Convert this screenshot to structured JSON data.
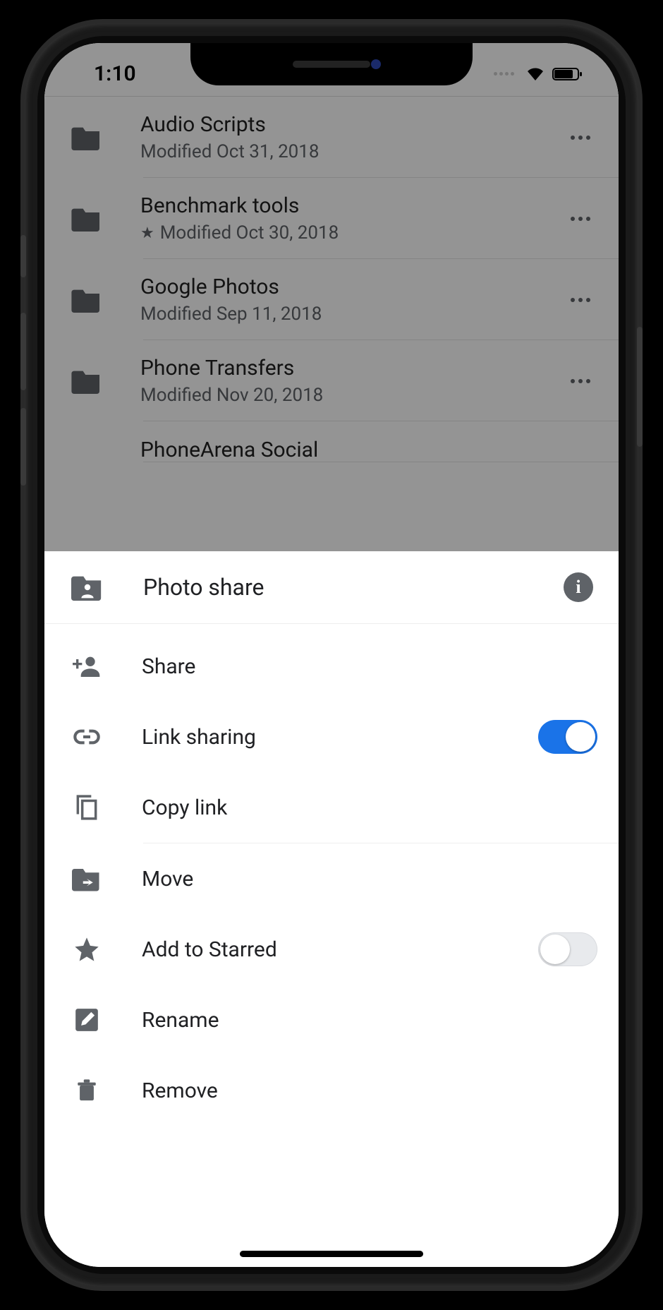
{
  "status": {
    "time": "1:10"
  },
  "files": [
    {
      "name": "Audio Scripts",
      "meta": "Modified Oct 31, 2018",
      "starred": false
    },
    {
      "name": "Benchmark tools",
      "meta": "Modified Oct 30, 2018",
      "starred": true
    },
    {
      "name": "Google Photos",
      "meta": "Modified Sep 11, 2018",
      "starred": false
    },
    {
      "name": "Phone Transfers",
      "meta": "Modified Nov 20, 2018",
      "starred": false
    },
    {
      "name": "PhoneArena Social",
      "meta": "",
      "starred": false
    }
  ],
  "sheet": {
    "title": "Photo share",
    "actions": {
      "share": "Share",
      "link_sharing": "Link sharing",
      "link_sharing_on": true,
      "copy_link": "Copy link",
      "move": "Move",
      "add_starred": "Add to Starred",
      "starred_on": false,
      "rename": "Rename",
      "remove": "Remove"
    }
  },
  "colors": {
    "accent": "#1a73e8"
  }
}
